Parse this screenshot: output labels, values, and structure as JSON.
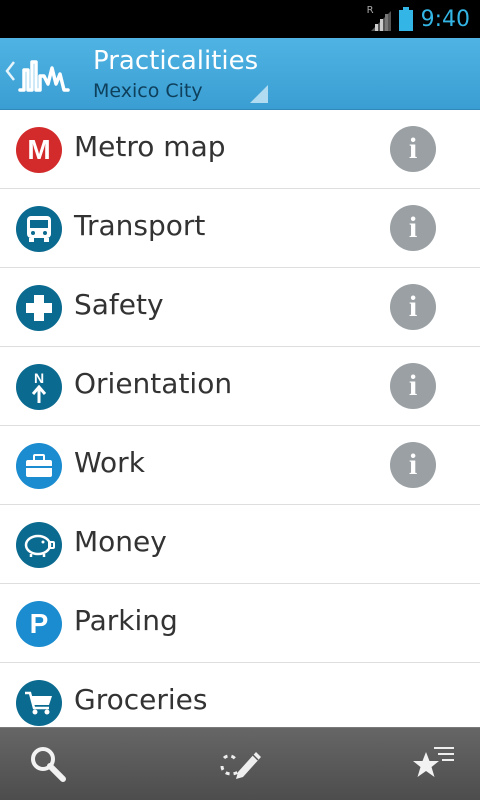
{
  "status_bar": {
    "network_badge": "R",
    "time": "9:40"
  },
  "action_bar": {
    "title": "Practicalities",
    "subtitle": "Mexico City"
  },
  "items": [
    {
      "label": "Metro map",
      "icon": "metro-icon",
      "icon_color": "#d32b2b",
      "icon_letter": "M",
      "has_info": true
    },
    {
      "label": "Transport",
      "icon": "bus-icon",
      "icon_color": "#0b6a8f",
      "has_info": true
    },
    {
      "label": "Safety",
      "icon": "first-aid-cross-icon",
      "icon_color": "#0b6a8f",
      "has_info": true
    },
    {
      "label": "Orientation",
      "icon": "north-arrow-icon",
      "icon_color": "#0b6a8f",
      "icon_letter": "N",
      "has_info": true
    },
    {
      "label": "Work",
      "icon": "briefcase-icon",
      "icon_color": "#1a8ccf",
      "has_info": true
    },
    {
      "label": "Money",
      "icon": "piggy-bank-icon",
      "icon_color": "#0b6a8f",
      "has_info": false
    },
    {
      "label": "Parking",
      "icon": "parking-icon",
      "icon_color": "#1a8ccf",
      "icon_letter": "P",
      "has_info": false
    },
    {
      "label": "Groceries",
      "icon": "shopping-cart-icon",
      "icon_color": "#0b6a8f",
      "has_info": false
    }
  ],
  "info_glyph": "i",
  "colors": {
    "action_bar": "#3fa8dc",
    "clock": "#33b5e5",
    "info": "#9aa0a3",
    "bottom_bar": "#5a5a5a"
  },
  "bottom_bar": {
    "buttons": [
      "search-icon",
      "route-pencil-icon",
      "favorites-star-icon"
    ]
  }
}
